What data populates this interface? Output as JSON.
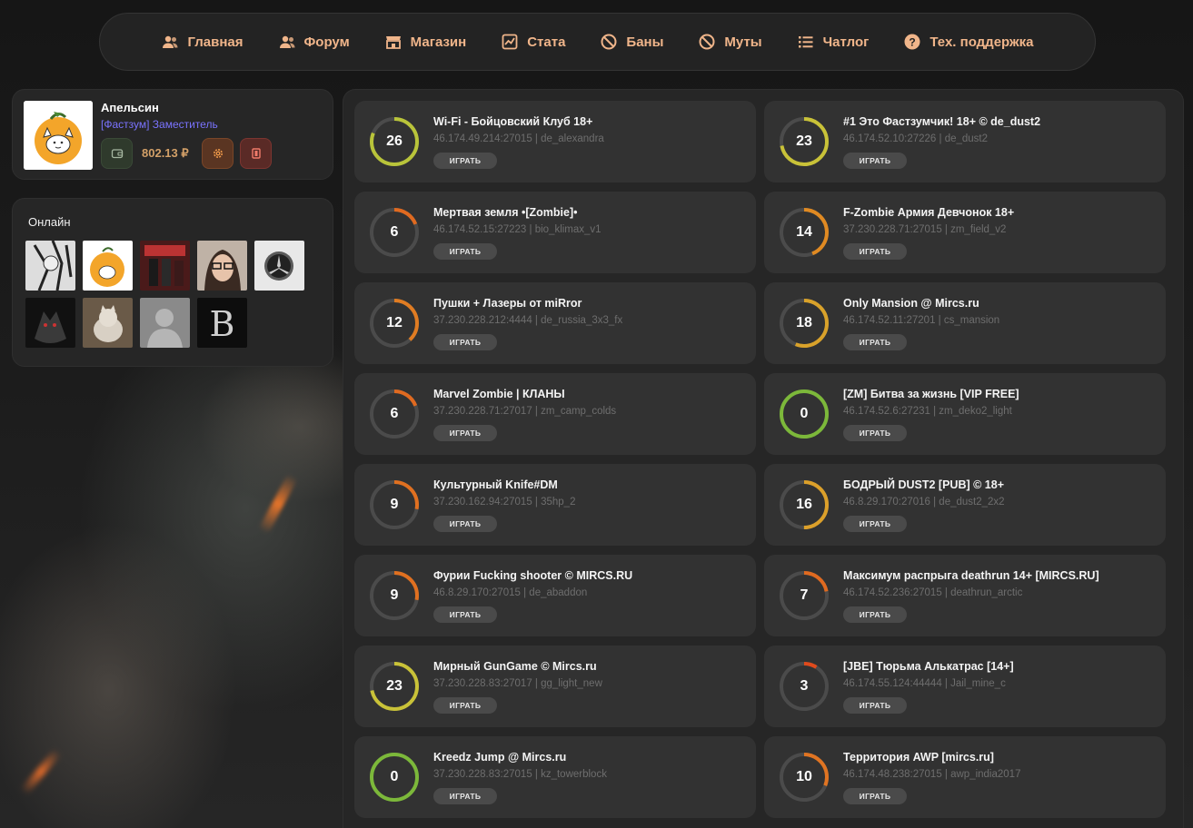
{
  "nav": {
    "items": [
      {
        "label": "Главная",
        "icon": "users-icon"
      },
      {
        "label": "Форум",
        "icon": "users-icon"
      },
      {
        "label": "Магазин",
        "icon": "store-icon"
      },
      {
        "label": "Стата",
        "icon": "chart-icon"
      },
      {
        "label": "Баны",
        "icon": "ban-icon"
      },
      {
        "label": "Муты",
        "icon": "ban-icon"
      },
      {
        "label": "Чатлог",
        "icon": "list-icon"
      },
      {
        "label": "Тех. поддержка",
        "icon": "question-icon"
      }
    ],
    "accent": "#f0b58a"
  },
  "profile": {
    "name": "Апельсин",
    "role": "[Фастзум] Заместитель",
    "balance": "802.13 ₽",
    "role_color": "#7a73ff"
  },
  "online": {
    "title": "Онлайн",
    "users": [
      {
        "avatar": "avatar-anime-bw"
      },
      {
        "avatar": "avatar-orange-cat"
      },
      {
        "avatar": "avatar-arcade"
      },
      {
        "avatar": "avatar-girl-glasses"
      },
      {
        "avatar": "avatar-mercedes"
      },
      {
        "avatar": "avatar-wolf"
      },
      {
        "avatar": "avatar-cat-photo"
      },
      {
        "avatar": "avatar-default"
      },
      {
        "avatar": "avatar-letter-b"
      }
    ]
  },
  "servers": {
    "play_label": "ИГРАТЬ",
    "items": [
      {
        "name": "Wi-Fi - Бойцовский Клуб 18+",
        "address": "46.174.49.214:27015 | de_alexandra",
        "players": "26",
        "fill": 0.81,
        "color": "#b9c43a"
      },
      {
        "name": "#1 Это Фастзумчик! 18+ © de_dust2",
        "address": "46.174.52.10:27226 | de_dust2",
        "players": "23",
        "fill": 0.72,
        "color": "#c9c238"
      },
      {
        "name": "Мертвая земля •[Zombie]•",
        "address": "46.174.52.15:27223 | bio_klimax_v1",
        "players": "6",
        "fill": 0.19,
        "color": "#e06a20"
      },
      {
        "name": "F-Zombie Армия Девчонок 18+",
        "address": "37.230.228.71:27015 | zm_field_v2",
        "players": "14",
        "fill": 0.44,
        "color": "#e08a22"
      },
      {
        "name": "Пушки + Лазеры от miRror",
        "address": "37.230.228.212:4444 | de_russia_3x3_fx",
        "players": "12",
        "fill": 0.38,
        "color": "#e07c22"
      },
      {
        "name": "Only Mansion @ Mircs.ru",
        "address": "46.174.52.11:27201 | cs_mansion",
        "players": "18",
        "fill": 0.56,
        "color": "#d9a22a"
      },
      {
        "name": "Marvel Zombie | КЛАНЫ",
        "address": "37.230.228.71:27017 | zm_camp_colds",
        "players": "6",
        "fill": 0.19,
        "color": "#e06a20"
      },
      {
        "name": "[ZM] Битва за жизнь [VIP FREE]",
        "address": "46.174.52.6:27231 | zm_deko2_light",
        "players": "0",
        "fill": 1.0,
        "color": "#7cb83a"
      },
      {
        "name": "Культурный Knife#DM",
        "address": "37.230.162.94:27015 | 35hp_2",
        "players": "9",
        "fill": 0.28,
        "color": "#e07020"
      },
      {
        "name": "БОДРЫЙ DUST2 [PUB] © 18+",
        "address": "46.8.29.170:27016 | de_dust2_2x2",
        "players": "16",
        "fill": 0.5,
        "color": "#dca02a"
      },
      {
        "name": "Фурии Fucking shooter © MIRCS.RU",
        "address": "46.8.29.170:27015 | de_abaddon",
        "players": "9",
        "fill": 0.28,
        "color": "#e07020"
      },
      {
        "name": "Максимум распрыга deathrun 14+ [MIRCS.RU]",
        "address": "46.174.52.236:27015 | deathrun_arctic",
        "players": "7",
        "fill": 0.22,
        "color": "#e06a20"
      },
      {
        "name": "Мирный GunGame © Mircs.ru",
        "address": "37.230.228.83:27017 | gg_light_new",
        "players": "23",
        "fill": 0.72,
        "color": "#c9c238"
      },
      {
        "name": "[JBE] Тюрьма Алькатрас [14+]",
        "address": "46.174.55.124:44444 | Jail_mine_c",
        "players": "3",
        "fill": 0.09,
        "color": "#e04a1c"
      },
      {
        "name": "Kreedz Jump @ Mircs.ru",
        "address": "37.230.228.83:27015 | kz_towerblock",
        "players": "0",
        "fill": 1.0,
        "color": "#7cb83a"
      },
      {
        "name": "Территория AWP [mircs.ru]",
        "address": "46.174.48.238:27015 | awp_india2017",
        "players": "10",
        "fill": 0.31,
        "color": "#e07422"
      }
    ]
  }
}
